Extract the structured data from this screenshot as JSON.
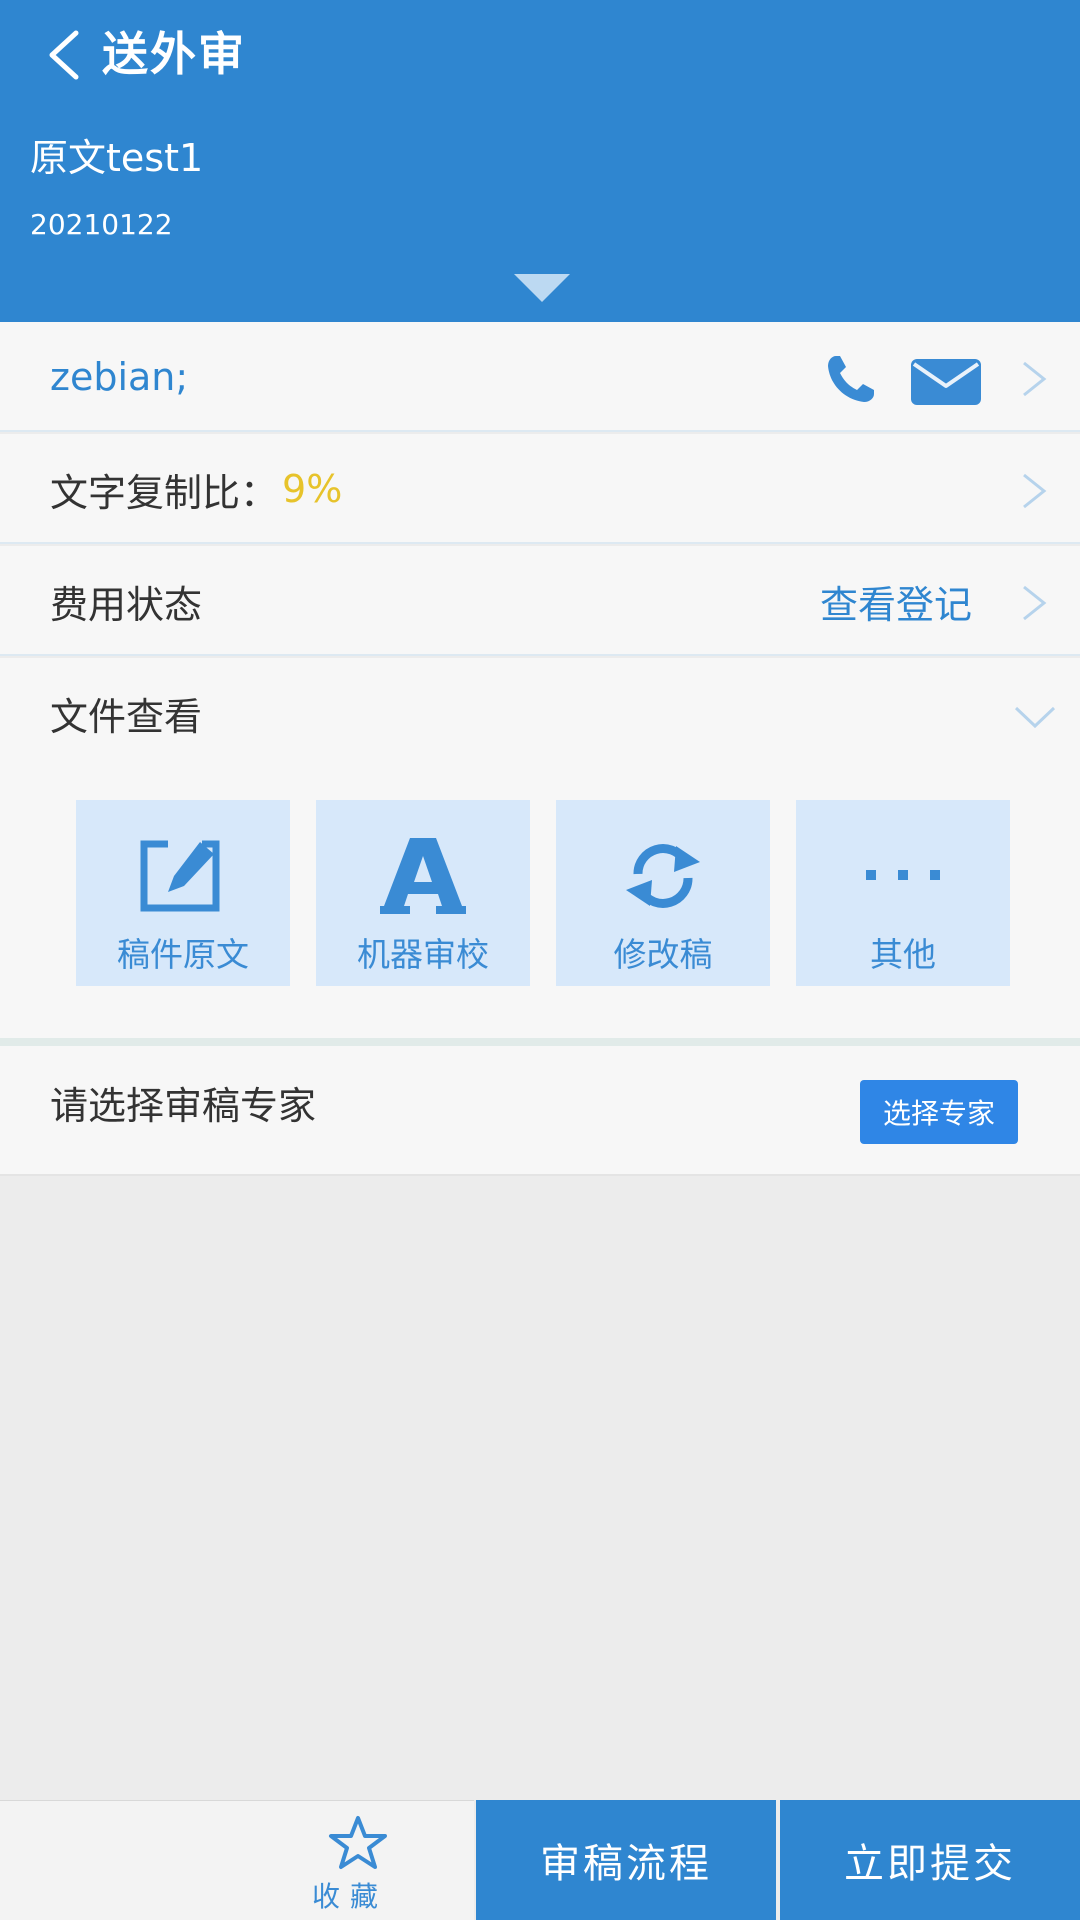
{
  "header": {
    "title": "送外审",
    "doc_title": "原文test1",
    "doc_date": "20210122"
  },
  "contact": {
    "name": "zebian;"
  },
  "copy_ratio": {
    "label": "文字复制比：",
    "value": "9%"
  },
  "fee": {
    "label": "费用状态",
    "link": "查看登记"
  },
  "files": {
    "label": "文件查看",
    "buttons": [
      {
        "label": "稿件原文",
        "icon": "edit-icon"
      },
      {
        "label": "机器审校",
        "icon": "letter-a-icon"
      },
      {
        "label": "修改稿",
        "icon": "refresh-icon"
      },
      {
        "label": "其他",
        "icon": "more-icon"
      }
    ]
  },
  "expert": {
    "label": "请选择审稿专家",
    "button": "选择专家"
  },
  "bottom": {
    "favorite": "收藏",
    "flow": "审稿流程",
    "submit": "立即提交"
  },
  "colors": {
    "primary": "#2f86d0",
    "accent_value": "#e7c32b",
    "tile": "#d7e8fa"
  }
}
